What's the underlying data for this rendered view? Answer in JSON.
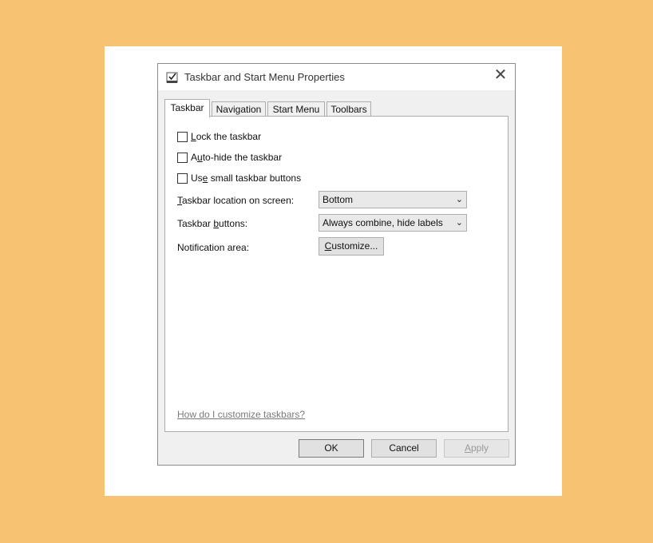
{
  "window": {
    "title": "Taskbar and Start Menu Properties",
    "close_glyph": "✕"
  },
  "tabs": [
    {
      "label": "Taskbar",
      "active": true
    },
    {
      "label": "Navigation",
      "active": false
    },
    {
      "label": "Start Menu",
      "active": false
    },
    {
      "label": "Toolbars",
      "active": false
    }
  ],
  "options": {
    "lock": {
      "mnemonic": "L",
      "rest": "ock the taskbar",
      "checked": false
    },
    "autohide": {
      "pre": "A",
      "mnemonic": "u",
      "rest": "to-hide the taskbar",
      "checked": false
    },
    "small": {
      "pre": "Us",
      "mnemonic": "e",
      "rest": " small taskbar buttons",
      "checked": false
    }
  },
  "fields": {
    "location": {
      "mnemonic": "T",
      "rest": "askbar location on screen:",
      "value": "Bottom"
    },
    "buttons": {
      "pre": "Taskbar ",
      "mnemonic": "b",
      "rest": "uttons:",
      "value": "Always combine, hide labels"
    },
    "notification": {
      "label": "Notification area:",
      "button_mnemonic": "C",
      "button_rest": "ustomize..."
    }
  },
  "help_link": "How do I customize taskbars?",
  "footer": {
    "ok": "OK",
    "cancel": "Cancel",
    "apply_mnemonic": "A",
    "apply_rest": "pply"
  }
}
